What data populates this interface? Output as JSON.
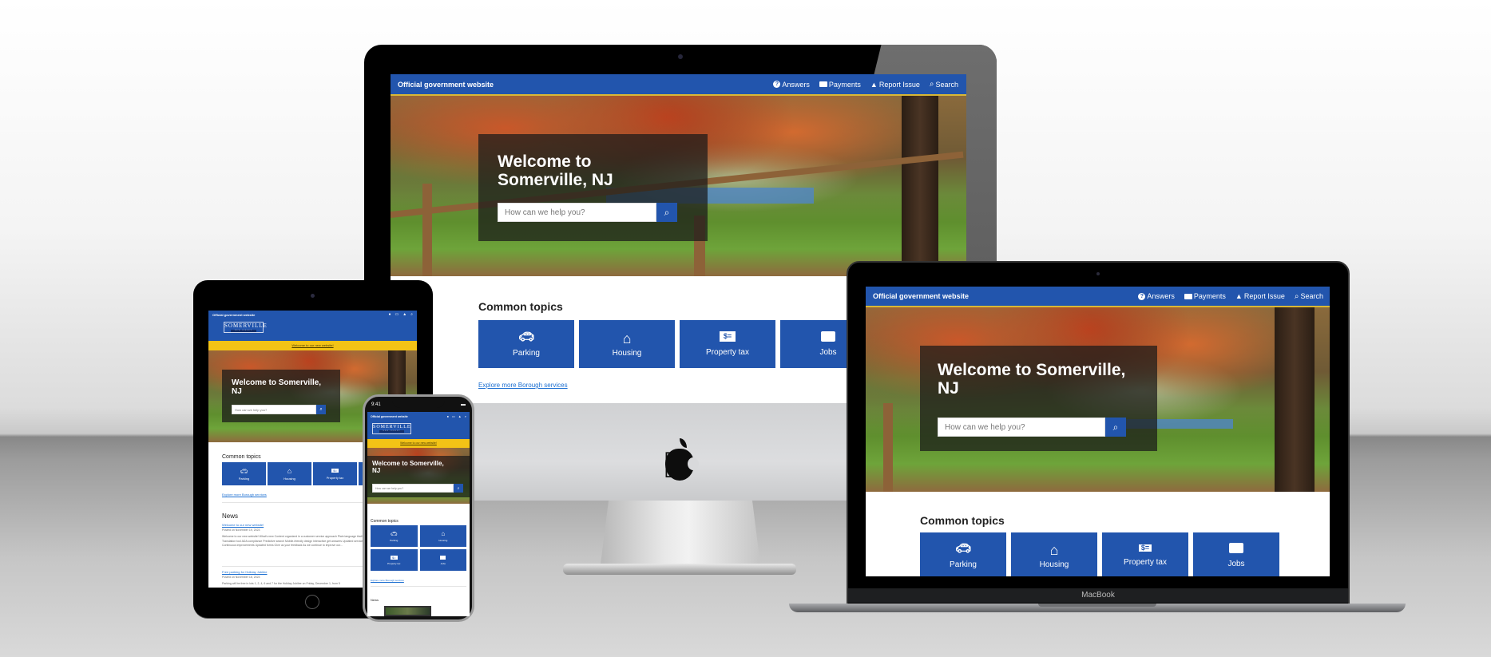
{
  "site": {
    "official_label": "Official government website",
    "nav": [
      {
        "label": "Answers",
        "icon": "question-circle-icon",
        "glyph": "?"
      },
      {
        "label": "Payments",
        "icon": "credit-card-icon",
        "glyph": "▭"
      },
      {
        "label": "Report Issue",
        "icon": "warning-triangle-icon",
        "glyph": "▲"
      },
      {
        "label": "Search",
        "icon": "search-icon",
        "glyph": "⌕"
      }
    ],
    "logo": {
      "name": "SOMERVILLE",
      "subtitle": "NEW JERSEY"
    },
    "banner": "Welcome to our new website!",
    "hero": {
      "title": "Welcome to Somerville, NJ",
      "title_line1": "Welcome to",
      "title_line2": "Somerville, NJ",
      "title_wide_line1": "Welcome to Somerville,",
      "title_wide_line2": "NJ",
      "search_placeholder": "How can we help you?",
      "search_button_icon": "⌕"
    },
    "topics": {
      "heading": "Common topics",
      "items": [
        {
          "label": "Parking",
          "icon": "car-icon",
          "glyph": "🚗"
        },
        {
          "label": "Housing",
          "icon": "house-icon",
          "glyph": "⌂"
        },
        {
          "label": "Property tax",
          "icon": "bill-icon",
          "glyph": "$="
        },
        {
          "label": "Jobs",
          "icon": "briefcase-icon",
          "glyph": "💼"
        }
      ],
      "explore_link": "Explore more Borough services"
    },
    "news": {
      "heading": "News",
      "items": [
        {
          "title": "Welcome to our new website!",
          "date": "Posted on November 19, 2023",
          "excerpt": "Welcome to our new website! What's new Content organized in a customer service approach Plain language that's easy to understand on the first read Translation tool ADA compliance Predictive search Mobile-friendly design Interactive get answers Updated services information What's up next: Continuous improvements Updated forms Give us your feedback As we continue to improve our..."
        },
        {
          "title": "Free parking for Holiday Jubilee",
          "date": "Posted on November 18, 2023",
          "excerpt": "Parking will be free in lots 1, 2, 4, 6 and 7 for the Holiday Jubilee on Friday, December 1, from 5"
        }
      ]
    }
  },
  "devices": {
    "phone_time": "9:41",
    "laptop_label": "MacBook"
  },
  "colors": {
    "brand_blue": "#2255ad",
    "banner_yellow": "#f3c316",
    "link_blue": "#1c6fd1"
  }
}
